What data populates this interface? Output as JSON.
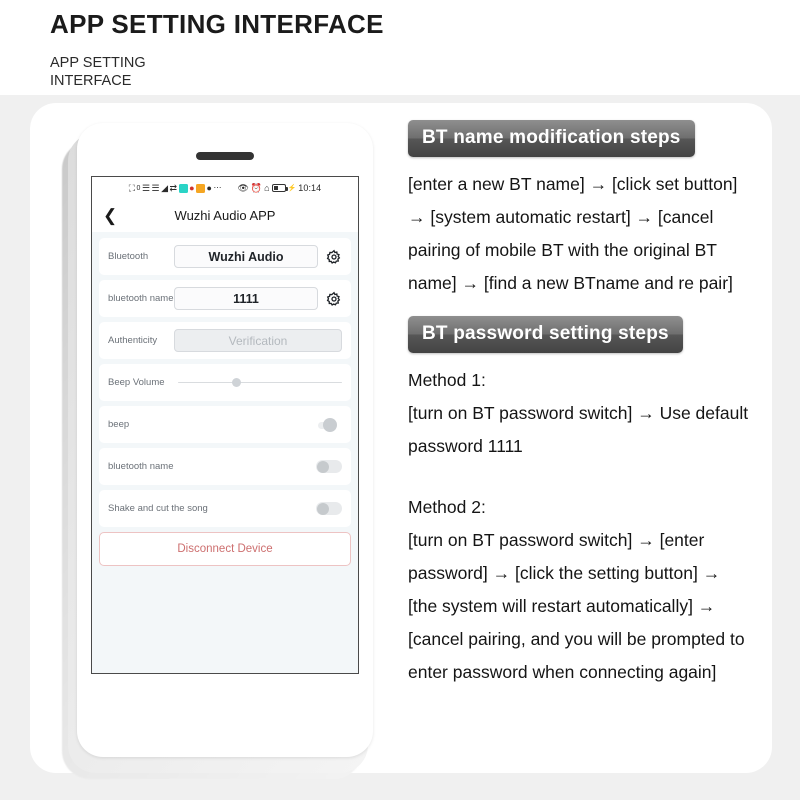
{
  "header": {
    "title": "APP SETTING INTERFACE",
    "subtitle": "APP SETTING INTERFACE"
  },
  "colors": {
    "page_background": "#ffffff",
    "panel_background": "#f0f0f0",
    "card_background": "#ffffff",
    "banner_gradient_top": "#8f8f8f",
    "banner_gradient_bottom": "#434343",
    "banner_text": "#ffffff",
    "screen_background": "#f3f7f9",
    "row_background": "#ffffff",
    "label_text": "#6b7178",
    "value_text": "#1f2328",
    "disconnect_text": "#cd6f6f",
    "disconnect_border": "#edc3c3",
    "status_chip_teal": "#2ad4c6",
    "status_chip_orange": "#f5a623"
  },
  "phone": {
    "statusbar": {
      "left_icons": [
        "camera-icon",
        "signal-bars-icon",
        "signal-bars-2-icon",
        "wifi-icon",
        "sync-icon",
        "app-chip-teal-icon",
        "qq-penguin-icon",
        "app-chip-orange-icon",
        "chat-bubble-icon",
        "more-dots-icon"
      ],
      "right_icons": [
        "eye-icon",
        "alarm-icon",
        "bluetooth-icon",
        "battery-icon",
        "charging-bolt-icon"
      ],
      "time": "10:14",
      "sim_count": "0"
    },
    "appbar": {
      "back_icon": "chevron-left-icon",
      "title": "Wuzhi Audio APP"
    },
    "rows": [
      {
        "label": "Bluetooth",
        "type": "value_gear",
        "value": "Wuzhi Audio",
        "gear_icon": "gear-icon"
      },
      {
        "label": "bluetooth name",
        "type": "value_gear",
        "value": "1111",
        "gear_icon": "gear-icon"
      },
      {
        "label": "Authenticity",
        "type": "value_muted",
        "value": "Verification"
      },
      {
        "label": "Beep Volume",
        "type": "slider",
        "value": "33"
      },
      {
        "label": "beep",
        "type": "toggle_plain",
        "value": "off"
      },
      {
        "label": "bluetooth name",
        "type": "toggle",
        "value": "off"
      },
      {
        "label": "Shake and cut the song",
        "type": "toggle",
        "value": "off"
      }
    ],
    "disconnect_label": "Disconnect Device"
  },
  "instructions": {
    "section1": {
      "banner": "BT name modification steps",
      "body": "[enter a new BT name] → [click set button] → [system automatic restart] → [cancel pairing of mobile BT with the original BT name] → [find a new BTname and re pair]"
    },
    "section2": {
      "banner": "BT password setting steps",
      "method1_title": "Method 1:",
      "method1_body": "[turn on BT password switch] → Use default password 1111",
      "method2_title": "Method 2:",
      "method2_body": "[turn on BT password switch] → [enter password] → [click the setting button] → [the system will restart automatically] → [cancel pairing, and you will be prompted to enter password when connecting again]"
    }
  }
}
